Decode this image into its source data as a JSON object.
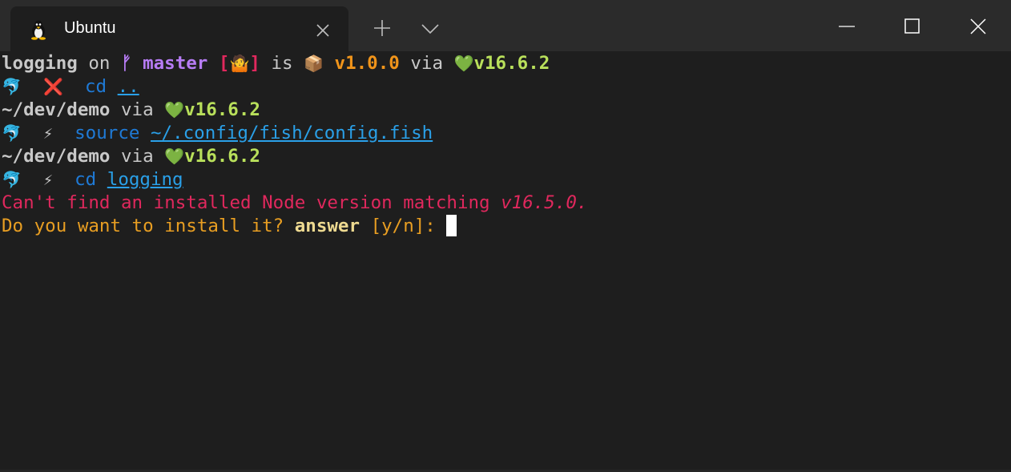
{
  "window": {
    "tab_title": "Ubuntu",
    "tab_icon": "linux-penguin-icon"
  },
  "terminal": {
    "line1": {
      "dir": "logging",
      "on": " on ",
      "branch_icon": "ᚠ",
      "branch": " master ",
      "status_open": "[",
      "status_emoji": "🤷",
      "status_close": "]",
      "is": " is ",
      "package_emoji": "📦",
      "pkg_version": " v1.0.0",
      "via": " via ",
      "node_emoji": "💚",
      "node_version": "v16.6.2"
    },
    "line2": {
      "prompt_emoji": "🐬",
      "status_emoji": "❌",
      "cmd": "cd",
      "arg": ".."
    },
    "line3": {
      "dir": "~/dev/demo",
      "via": " via ",
      "node_emoji": "💚",
      "node_version": "v16.6.2"
    },
    "line4": {
      "prompt_emoji": "🐬",
      "status_emoji": "⚡",
      "cmd": "source",
      "arg": "~/.config/fish/config.fish"
    },
    "line5": {
      "dir": "~/dev/demo",
      "via": " via ",
      "node_emoji": "💚",
      "node_version": "v16.6.2"
    },
    "line6": {
      "prompt_emoji": "🐬",
      "status_emoji": "⚡",
      "cmd": "cd",
      "arg": "logging"
    },
    "line7": {
      "text": "Can't find an installed Node version matching ",
      "version": "v16.5.0."
    },
    "line8": {
      "text": "Do you want to install it? ",
      "answer": "answer",
      "options": " [y/n]: "
    }
  },
  "colors": {
    "background": "#1e1e1e",
    "titlebar": "#2b2b2b",
    "purple": "#b77cf5",
    "orange": "#f0941a",
    "green": "#b9e05b",
    "blue": "#1f7ad6",
    "link": "#2aa0e8",
    "error_red": "#e0285d",
    "prompt_yellow": "#e89e22"
  }
}
